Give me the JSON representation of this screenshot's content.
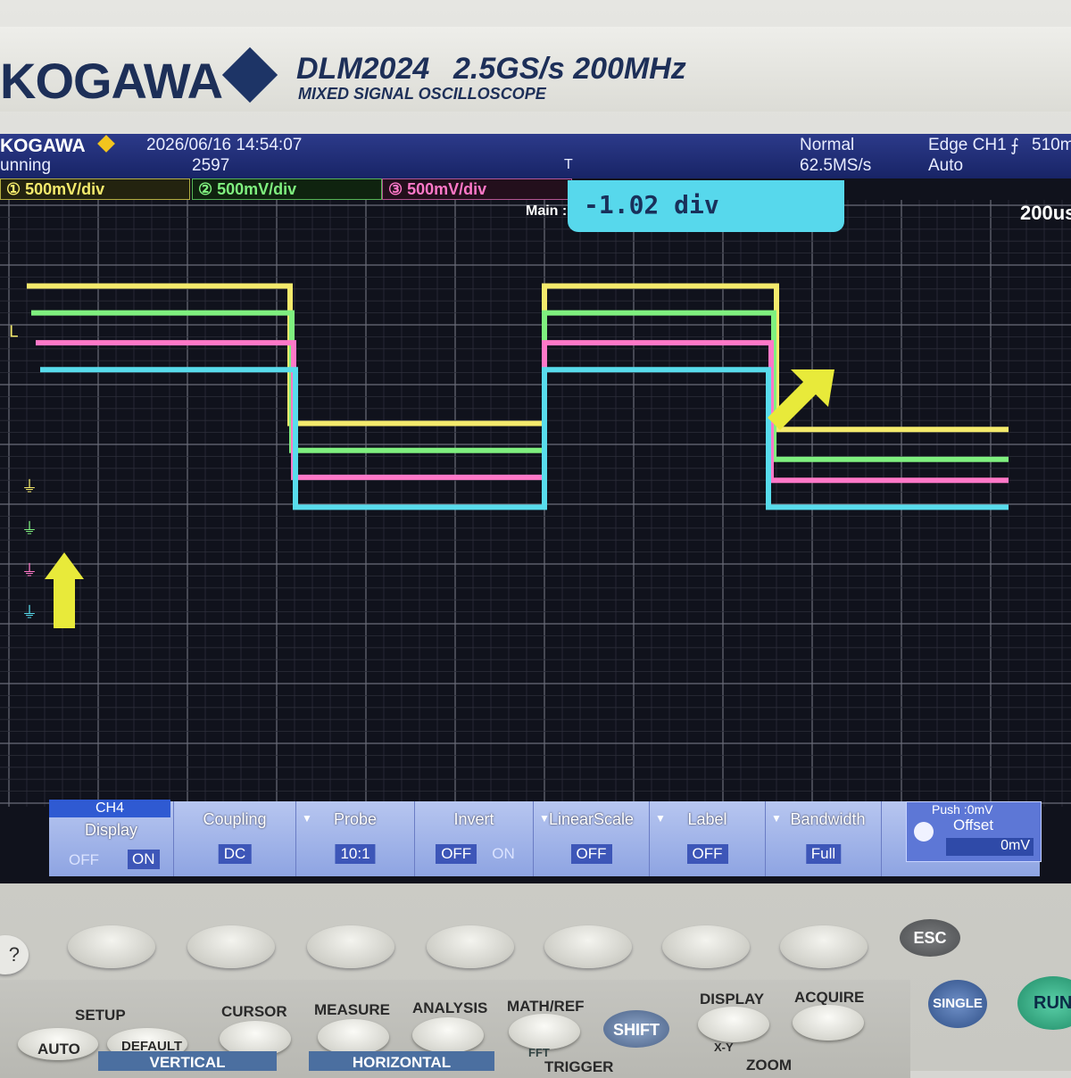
{
  "brand": {
    "logo": "KOGAWA",
    "model": "DLM2024",
    "spec": "2.5GS/s 200MHz",
    "subtitle": "MIXED SIGNAL OSCILLOSCOPE"
  },
  "status_bar": {
    "logo": "KOGAWA",
    "datetime": "2026/06/16 14:54:07",
    "run_state": "unning",
    "acq_count": "2597",
    "mode": "Normal",
    "sample_rate": "62.5MS/s",
    "trigger": "Edge CH1",
    "trigger_level": "510m",
    "trigger_mode": "Auto",
    "trigger_pos_marker": "T"
  },
  "channels": [
    {
      "id": "1",
      "scale": "500mV/div",
      "color": "#f4ea6c"
    },
    {
      "id": "2",
      "scale": "500mV/div",
      "color": "#7ff07f"
    },
    {
      "id": "3",
      "scale": "500mV/div",
      "color": "#ff78c8"
    },
    {
      "id": "4",
      "color": "#58dcec"
    }
  ],
  "cursor_readout": "-1.02 div",
  "main_label": "Main :",
  "timebase": "200us",
  "waveforms": {
    "note_levels_in_div_from_top": true,
    "segments_x_div": [
      0.2,
      3.15,
      6.0,
      8.6,
      11.2
    ],
    "levels": {
      "ch1": [
        [
          1.35,
          3.65
        ],
        [
          1.35,
          3.75
        ]
      ],
      "ch2": [
        [
          1.8,
          4.1
        ],
        [
          1.8,
          4.25
        ]
      ],
      "ch3": [
        [
          2.3,
          4.55
        ],
        [
          2.3,
          4.6
        ]
      ],
      "ch4": [
        [
          2.75,
          5.05
        ],
        [
          2.75,
          5.05
        ]
      ]
    }
  },
  "menu": {
    "channel": "CH4",
    "display": {
      "title": "Display",
      "off": "OFF",
      "on": "ON"
    },
    "coupling": {
      "title": "Coupling",
      "value": "DC"
    },
    "probe": {
      "title": "Probe",
      "value": "10:1"
    },
    "invert": {
      "title": "Invert",
      "off": "OFF",
      "on": "ON"
    },
    "linear_scale": {
      "title": "LinearScale",
      "value": "OFF"
    },
    "label": {
      "title": "Label",
      "value": "OFF"
    },
    "bandwidth": {
      "title": "Bandwidth",
      "value": "Full"
    },
    "offset": {
      "push": "Push :0mV",
      "title": "Offset",
      "value": "0mV"
    }
  },
  "panel": {
    "esc": "ESC",
    "help": "?",
    "setup": "SETUP",
    "auto": "AUTO",
    "default": "DEFAULT",
    "cursor": "CURSOR",
    "measure": "MEASURE",
    "analysis": "ANALYSIS",
    "math_ref": "MATH/REF",
    "shift": "SHIFT",
    "fft": "FFT",
    "display": "DISPLAY",
    "xy": "X-Y",
    "acquire": "ACQUIRE",
    "single": "SINGLE",
    "run": "RUN",
    "vertical": "VERTICAL",
    "horizontal": "HORIZONTAL",
    "trigger": "TRIGGER",
    "zoom": "ZOOM"
  }
}
